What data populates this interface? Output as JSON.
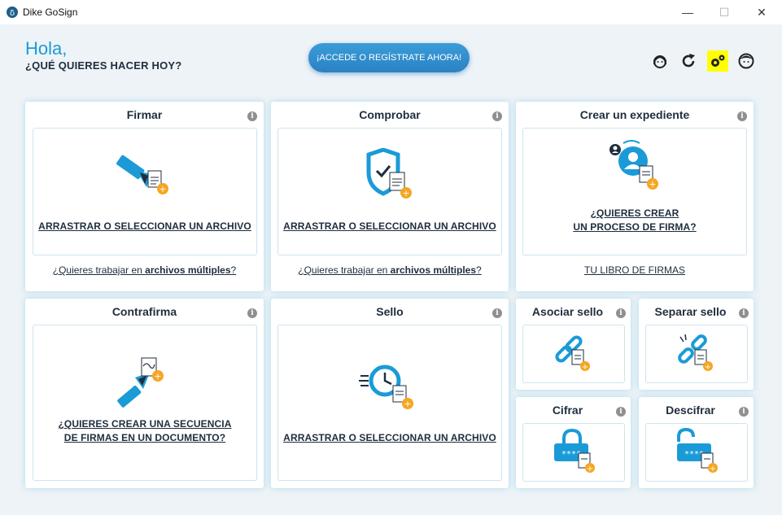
{
  "window": {
    "title": "Dike GoSign",
    "min": "—",
    "max": "☐",
    "close": "✕"
  },
  "header": {
    "greeting": "Hola,",
    "question": "¿QUÉ QUIERES HACER HOY?",
    "cta": "¡ACCEDE O REGÍSTRATE AHORA!"
  },
  "top_icons": [
    "support-agent-icon",
    "refresh-icon",
    "settings-gears-icon",
    "user-profile-icon"
  ],
  "colors": {
    "accent": "#1a9bd7",
    "orange": "#f5a623",
    "dark": "#1f2d3d",
    "highlight": "#ffff00"
  },
  "cards": {
    "firmar": {
      "title": "Firmar",
      "action": "ARRASTRAR O SELECCIONAR UN ARCHIVO",
      "multi_pre": "¿Quieres trabajar en ",
      "multi_bold": "archivos múltiples",
      "multi_post": "?"
    },
    "comprobar": {
      "title": "Comprobar",
      "action": "ARRASTRAR O SELECCIONAR UN ARCHIVO",
      "multi_pre": "¿Quieres trabajar en ",
      "multi_bold": "archivos múltiples",
      "multi_post": "?"
    },
    "expediente": {
      "title": "Crear un expediente",
      "action_line1": "¿QUIERES CREAR",
      "action_line2": "UN PROCESO DE FIRMA?",
      "footer": "TU LIBRO DE FIRMAS"
    },
    "contrafirma": {
      "title": "Contrafirma",
      "action_line1": "¿QUIERES CREAR UNA SECUENCIA",
      "action_line2": "DE FIRMAS EN UN DOCUMENTO?"
    },
    "sello": {
      "title": "Sello",
      "action": "ARRASTRAR O SELECCIONAR UN ARCHIVO"
    },
    "asociar": {
      "title": "Asociar sello"
    },
    "separar": {
      "title": "Separar sello"
    },
    "cifrar": {
      "title": "Cifrar",
      "mask": "****"
    },
    "descifrar": {
      "title": "Descifrar",
      "mask": "****"
    }
  }
}
